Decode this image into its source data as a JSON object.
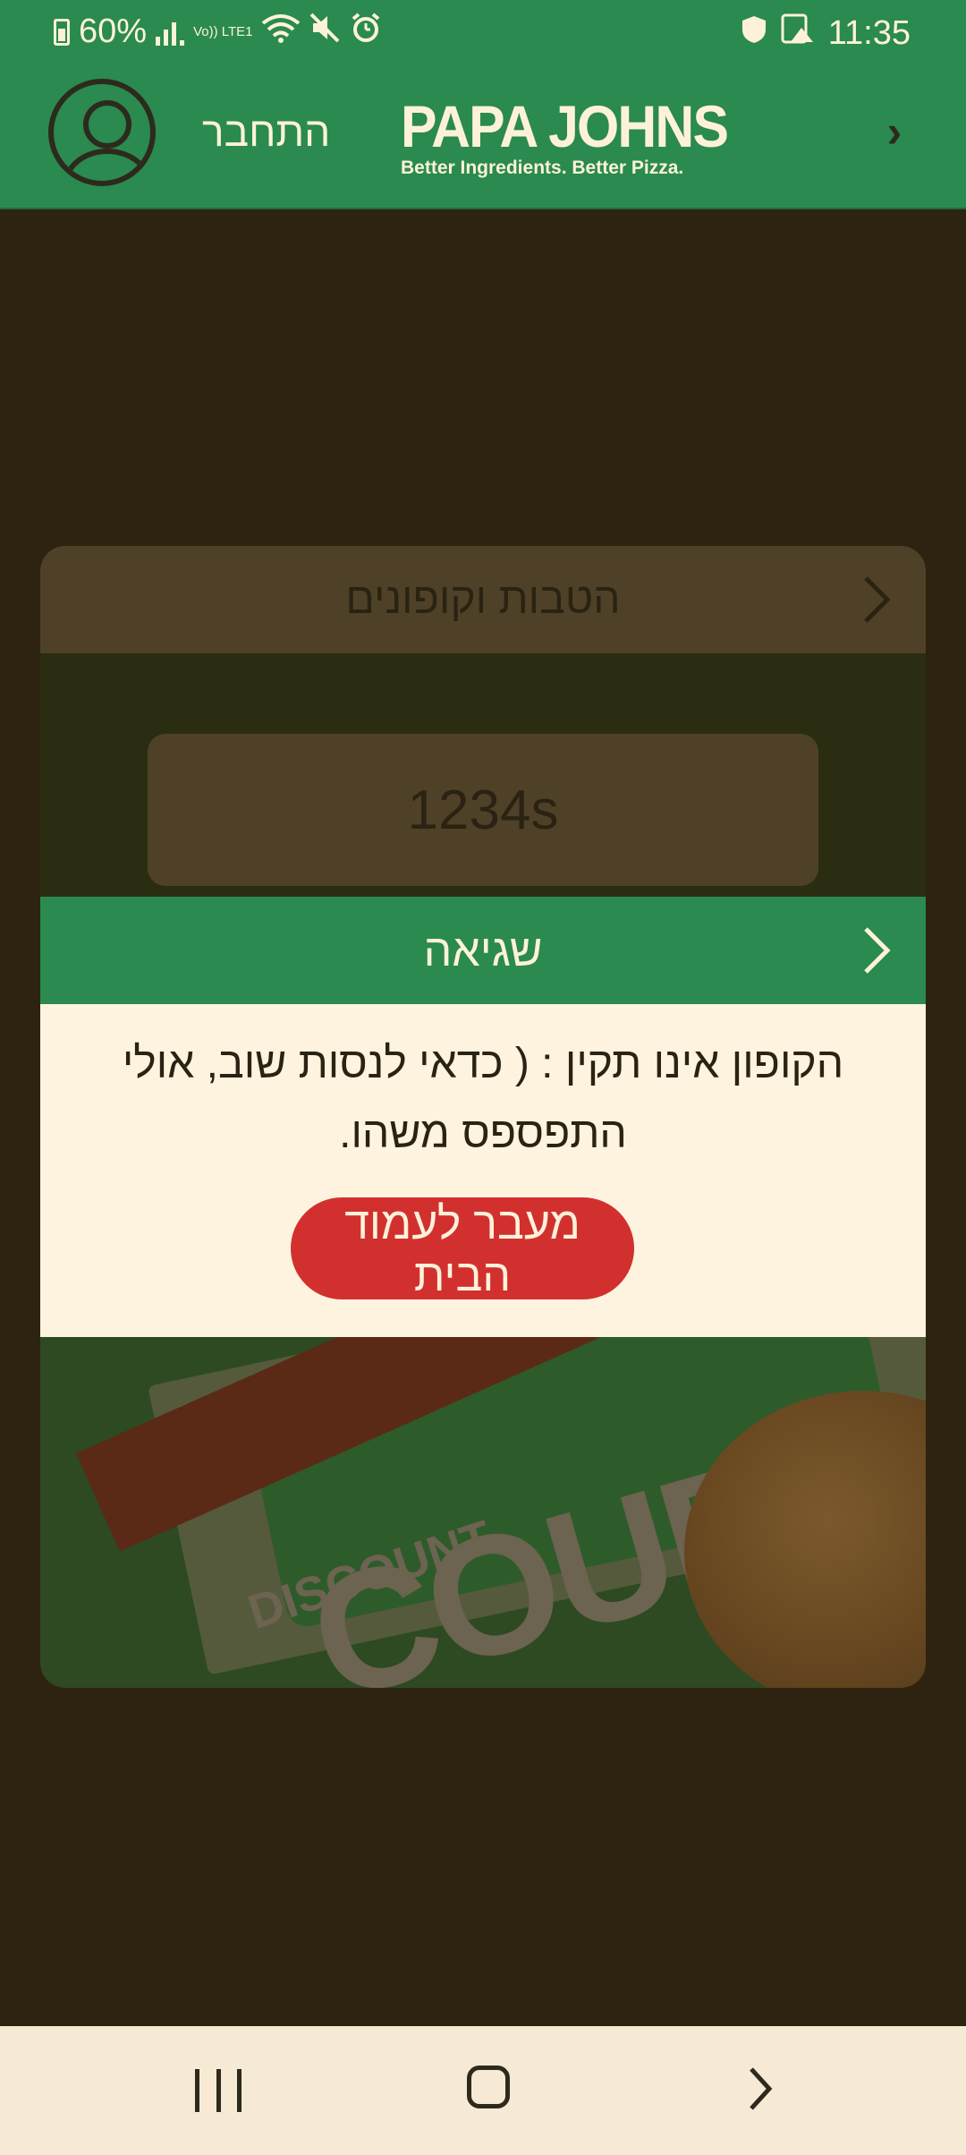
{
  "status_bar": {
    "battery": "60%",
    "lte": "Vo)) LTE1",
    "time": "11:35"
  },
  "header": {
    "login_label": "התחבר",
    "logo_text": "PAPA JOHNS",
    "logo_tagline": "Better Ingredients. Better Pizza.",
    "back_icon": "chevron-right-icon"
  },
  "coupons_card": {
    "title": "הטבות וקופונים",
    "coupon_value": "1234s",
    "banner_ribbon": "DISCOUNT",
    "banner_text": "COUPON"
  },
  "error_dialog": {
    "title": "שגיאה",
    "message": "הקופון אינו תקין : ( כדאי לנסות שוב, אולי התפספס משהו.",
    "button_label": "מעבר לעמוד הבית"
  },
  "colors": {
    "brand_green": "#2a8a4f",
    "button_red": "#d2302f",
    "dialog_background": "#fdf3de",
    "overlay": "#2d2310"
  }
}
